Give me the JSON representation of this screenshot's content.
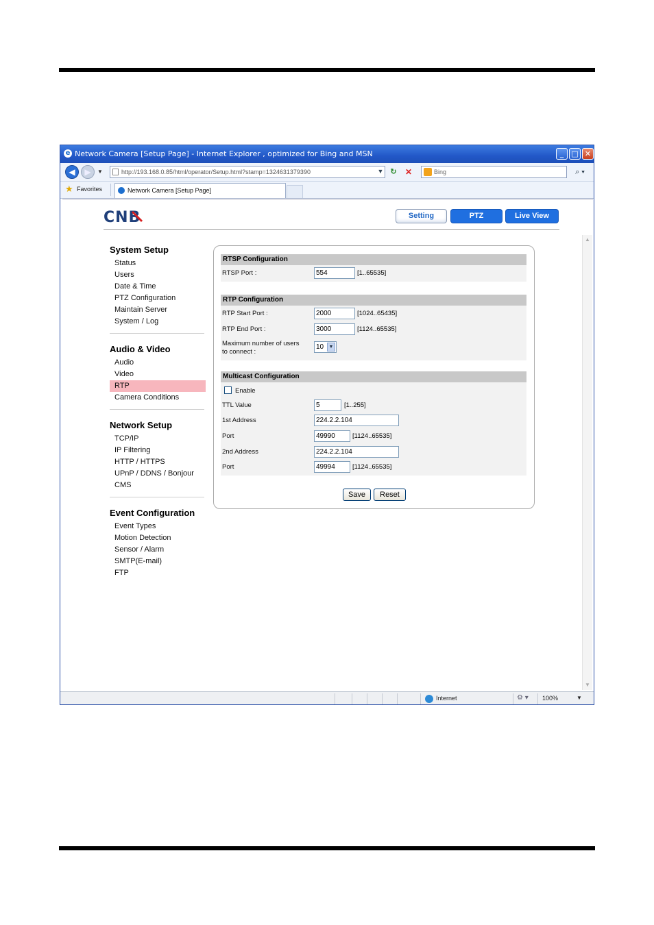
{
  "window": {
    "title": "Network Camera [Setup Page] - Internet Explorer , optimized for Bing and MSN",
    "url": "http://193.168.0.85/html/operator/Setup.html?stamp=1324631379390",
    "search_placeholder": "Bing",
    "favorites_label": "Favorites",
    "tab_title": "Network Camera [Setup Page]",
    "status_zone": "Internet",
    "zoom": "100%"
  },
  "header": {
    "logo": "CNB",
    "nav": {
      "setting": "Setting",
      "ptz": "PTZ",
      "live": "Live View"
    }
  },
  "menu": {
    "system": {
      "title": "System Setup",
      "items": [
        "Status",
        "Users",
        "Date & Time",
        "PTZ Configuration",
        "Maintain Server",
        "System / Log"
      ]
    },
    "audio_video": {
      "title": "Audio & Video",
      "items": [
        "Audio",
        "Video",
        "RTP",
        "Camera Conditions"
      ],
      "active": "RTP"
    },
    "network": {
      "title": "Network Setup",
      "items": [
        "TCP/IP",
        "IP Filtering",
        "HTTP / HTTPS",
        "UPnP / DDNS / Bonjour",
        "CMS"
      ]
    },
    "event": {
      "title": "Event Configuration",
      "items": [
        "Event Types",
        "Motion Detection",
        "Sensor / Alarm",
        "SMTP(E-mail)",
        "FTP"
      ]
    }
  },
  "rtsp": {
    "heading": "RTSP Configuration",
    "port_label": "RTSP Port :",
    "port_value": "554",
    "port_range": "[1..65535]"
  },
  "rtp": {
    "heading": "RTP Configuration",
    "start_label": "RTP Start Port :",
    "start_value": "2000",
    "start_range": "[1024..65435]",
    "end_label": "RTP End Port :",
    "end_value": "3000",
    "end_range": "[1124..65535]",
    "maxusers_label_1": "Maximum number of users",
    "maxusers_label_2": "to connect :",
    "maxusers_value": "10"
  },
  "multicast": {
    "heading": "Multicast Configuration",
    "enable_label": "Enable",
    "enabled": false,
    "ttl_label": "TTL Value",
    "ttl_value": "5",
    "ttl_range": "[1..255]",
    "addr1_label": "1st Address",
    "addr1_value": "224.2.2.104",
    "port1_label": "Port",
    "port1_value": "49990",
    "port1_range": "[1124..65535]",
    "addr2_label": "2nd Address",
    "addr2_value": "224.2.2.104",
    "port2_label": "Port",
    "port2_value": "49994",
    "port2_range": "[1124..65535]"
  },
  "buttons": {
    "save": "Save",
    "reset": "Reset"
  },
  "colors": {
    "accent": "#1f6fe0",
    "active_menu": "#f7b6bd",
    "section_header": "#c8c8c8"
  }
}
